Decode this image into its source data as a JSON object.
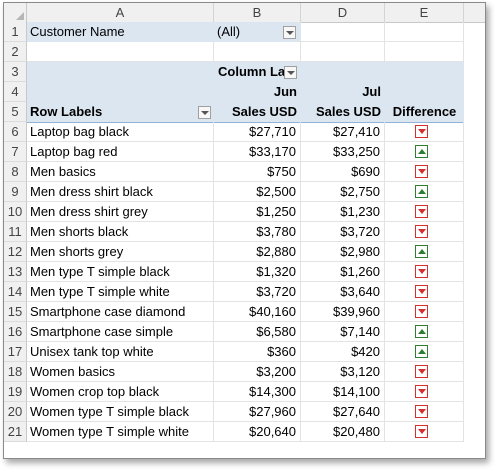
{
  "columns": [
    "A",
    "B",
    "D",
    "E"
  ],
  "row_numbers": [
    "1",
    "2",
    "3",
    "4",
    "5",
    "6",
    "7",
    "8",
    "9",
    "10",
    "11",
    "12",
    "13",
    "14",
    "15",
    "16",
    "17",
    "18",
    "19",
    "20",
    "21"
  ],
  "filter": {
    "label": "Customer Name",
    "value": "(All)"
  },
  "pivot": {
    "column_labels": "Column La",
    "months": [
      "Jun",
      "Jul"
    ],
    "row_labels": "Row Labels",
    "value_headers": [
      "Sales USD",
      "Sales USD"
    ],
    "difference_header": "Difference"
  },
  "rows": [
    {
      "label": "Laptop bag black",
      "jun": "$27,710",
      "jul": "$27,410",
      "trend": "down"
    },
    {
      "label": "Laptop bag red",
      "jun": "$33,170",
      "jul": "$33,250",
      "trend": "up"
    },
    {
      "label": "Men basics",
      "jun": "$750",
      "jul": "$690",
      "trend": "down"
    },
    {
      "label": "Men dress shirt black",
      "jun": "$2,500",
      "jul": "$2,750",
      "trend": "up"
    },
    {
      "label": "Men dress shirt grey",
      "jun": "$1,250",
      "jul": "$1,230",
      "trend": "down"
    },
    {
      "label": "Men shorts black",
      "jun": "$3,780",
      "jul": "$3,720",
      "trend": "down"
    },
    {
      "label": "Men shorts grey",
      "jun": "$2,880",
      "jul": "$2,980",
      "trend": "up"
    },
    {
      "label": "Men type T simple black",
      "jun": "$1,320",
      "jul": "$1,260",
      "trend": "down"
    },
    {
      "label": "Men type T simple white",
      "jun": "$3,720",
      "jul": "$3,640",
      "trend": "down"
    },
    {
      "label": "Smartphone case diamond",
      "jun": "$40,160",
      "jul": "$39,960",
      "trend": "down"
    },
    {
      "label": "Smartphone case simple",
      "jun": "$6,580",
      "jul": "$7,140",
      "trend": "up"
    },
    {
      "label": "Unisex tank top white",
      "jun": "$360",
      "jul": "$420",
      "trend": "up"
    },
    {
      "label": "Women basics",
      "jun": "$3,200",
      "jul": "$3,120",
      "trend": "down"
    },
    {
      "label": "Women crop top black",
      "jun": "$14,300",
      "jul": "$14,100",
      "trend": "down"
    },
    {
      "label": "Women type T simple black",
      "jun": "$27,960",
      "jul": "$27,640",
      "trend": "down"
    },
    {
      "label": "Women type T simple white",
      "jun": "$20,640",
      "jul": "$20,480",
      "trend": "down"
    }
  ],
  "colors": {
    "pivot_header_fill": "#dce6f1",
    "down": "#d32f2f",
    "up": "#2e7d32"
  }
}
